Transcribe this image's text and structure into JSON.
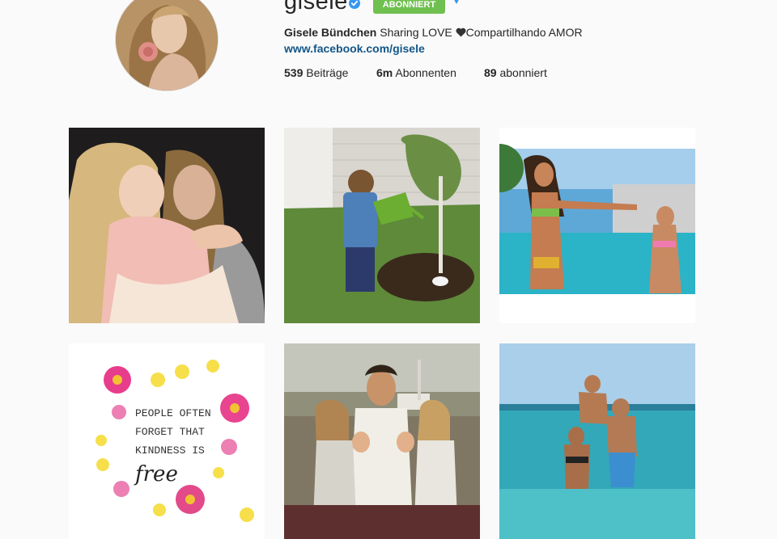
{
  "profile": {
    "username": "gisele",
    "verified_icon": "verified-badge-icon",
    "follow_label": "ABONNIERT",
    "dropdown_icon": "caret-down-icon",
    "full_name": "Gisele Bündchen",
    "bio_text": " Sharing LOVE ",
    "heart_icon": "heart-icon",
    "bio_text_2": "Compartilhando AMOR",
    "website": "www.facebook.com/gisele",
    "stats": {
      "posts_count": "539",
      "posts_label": " Beiträge",
      "followers_count": "6m",
      "followers_label": " Abonnenten",
      "following_count": "89",
      "following_label": " abonniert"
    }
  },
  "colors": {
    "accent_green": "#70c050",
    "link_blue": "#125688",
    "verified_blue": "#3897f0"
  },
  "posts": [
    {
      "id": "post-1",
      "icon": "photo-mother-daughter"
    },
    {
      "id": "post-2",
      "icon": "photo-child-watering-tree"
    },
    {
      "id": "post-3",
      "icon": "photo-pool-bikini"
    },
    {
      "id": "post-4",
      "icon": "photo-flowers-quote",
      "caption_lines": [
        "PEOPLE OFTEN",
        "FORGET THAT",
        "KINDNESS IS",
        "free"
      ]
    },
    {
      "id": "post-5",
      "icon": "photo-family-vintage"
    },
    {
      "id": "post-6",
      "icon": "photo-beach-family"
    }
  ]
}
